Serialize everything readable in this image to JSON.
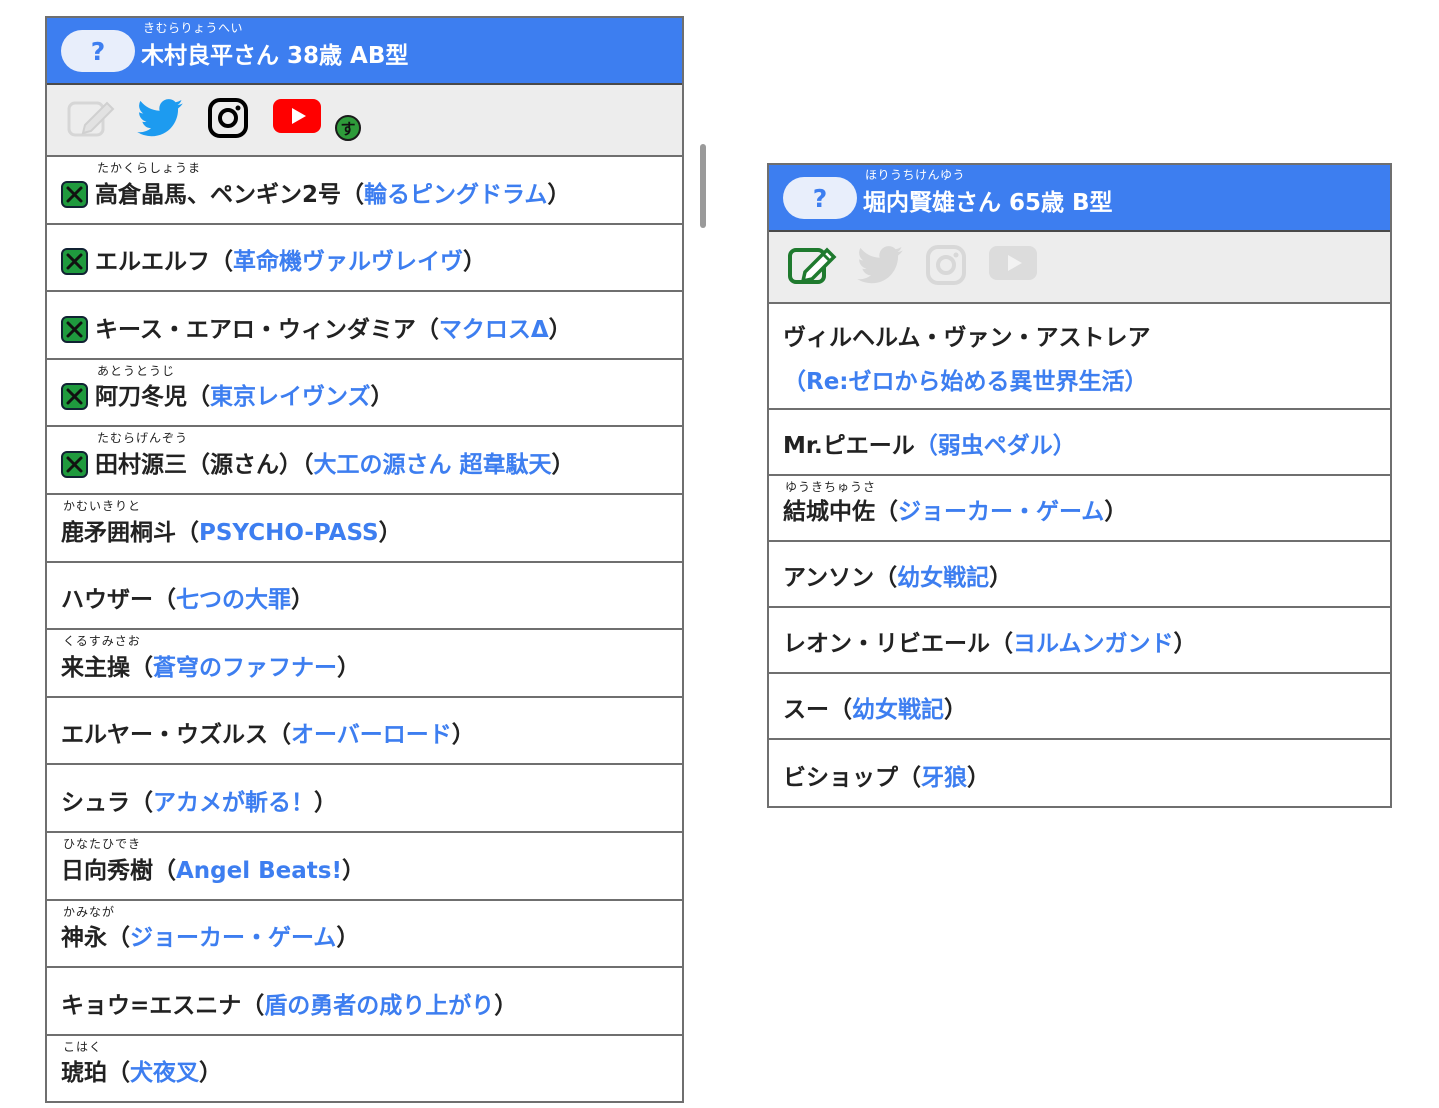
{
  "left": {
    "header": {
      "help": "?",
      "ruby": "きむらりょうへい",
      "title": "木村良平さん 38歳 AB型"
    },
    "icons": [
      "edit-icon-inactive",
      "twitter-icon",
      "instagram-icon",
      "youtube-icon",
      "su-badge-icon"
    ],
    "su_label": "す",
    "rows": [
      {
        "ruby": "たかくらしょうま",
        "name": "高倉晶馬、ペンギン2号",
        "open": "（",
        "work": "輪るピングドラム",
        "close": "）"
      },
      {
        "ruby": "",
        "name": "エルエルフ",
        "open": "（",
        "work": "革命機ヴァルヴレイヴ",
        "close": "）"
      },
      {
        "ruby": "",
        "name": "キース・エアロ・ウィンダミア",
        "open": "（",
        "work": "マクロスΔ",
        "close": "）"
      },
      {
        "ruby": "あとうとうじ",
        "name": "阿刀冬児",
        "open": "（",
        "work": "東京レイヴンズ",
        "close": "）"
      },
      {
        "ruby": "たむらげんぞう",
        "name": "田村源三（源さん）",
        "open": "（",
        "work": "大工の源さん 超韋駄天",
        "close": "）"
      },
      {
        "ruby": "かむいきりと",
        "name": "鹿矛囲桐斗",
        "open": "（",
        "work": "PSYCHO-PASS",
        "close": "）"
      },
      {
        "ruby": "",
        "name": "ハウザー",
        "open": "（",
        "work": "七つの大罪",
        "close": "）"
      },
      {
        "ruby": "くるすみさお",
        "name": "来主操",
        "open": "（",
        "work": "蒼穹のファフナー",
        "close": "）"
      },
      {
        "ruby": "",
        "name": "エルヤー・ウズルス",
        "open": "（",
        "work": "オーバーロード",
        "close": "）"
      },
      {
        "ruby": "",
        "name": "シュラ",
        "open": "（",
        "work": "アカメが斬る！",
        "close": "）"
      },
      {
        "ruby": "ひなたひでき",
        "name": "日向秀樹",
        "open": "（",
        "work": "Angel Beats!",
        "close": "）"
      },
      {
        "ruby": "かみなが",
        "name": "神永",
        "open": "（",
        "work": "ジョーカー・ゲーム",
        "close": "）"
      },
      {
        "ruby": "",
        "name": "キョウ=エスニナ",
        "open": "（",
        "work": "盾の勇者の成り上がり",
        "close": "）"
      },
      {
        "ruby": "こはく",
        "name": "琥珀",
        "open": "（",
        "work": "犬夜叉",
        "close": "）"
      }
    ]
  },
  "right": {
    "header": {
      "help": "?",
      "ruby": "ほりうちけんゆう",
      "title": "堀内賢雄さん 65歳 B型"
    },
    "icons": [
      "edit-icon-active",
      "twitter-icon-inactive",
      "instagram-icon-inactive",
      "youtube-icon-inactive"
    ],
    "rows": [
      {
        "ruby": "",
        "name": "ヴィルヘルム・ヴァン・アストレア",
        "open": "",
        "work": "（Re:ゼロから始める異世界生活）",
        "close": ""
      },
      {
        "ruby": "",
        "name": "Mr.ピエール",
        "open": "",
        "work": "（弱虫ペダル）",
        "close": ""
      },
      {
        "ruby": "ゆうきちゅうさ",
        "name": "結城中佐",
        "open": "（",
        "work": "ジョーカー・ゲーム",
        "close": "）"
      },
      {
        "ruby": "",
        "name": "アンソン",
        "open": "（",
        "work": "幼女戦記",
        "close": "）"
      },
      {
        "ruby": "",
        "name": "レオン・リビエール",
        "open": "（",
        "work": "ヨルムンガンド",
        "close": "）"
      },
      {
        "ruby": "",
        "name": "スー",
        "open": "（",
        "work": "幼女戦記",
        "close": "）"
      },
      {
        "ruby": "",
        "name": "ビショップ",
        "open": "（",
        "work": "牙狼",
        "close": "）"
      }
    ]
  },
  "colors": {
    "accent": "#3d7ef0",
    "check": "#1f9a3e",
    "iconbar": "#ededed"
  }
}
